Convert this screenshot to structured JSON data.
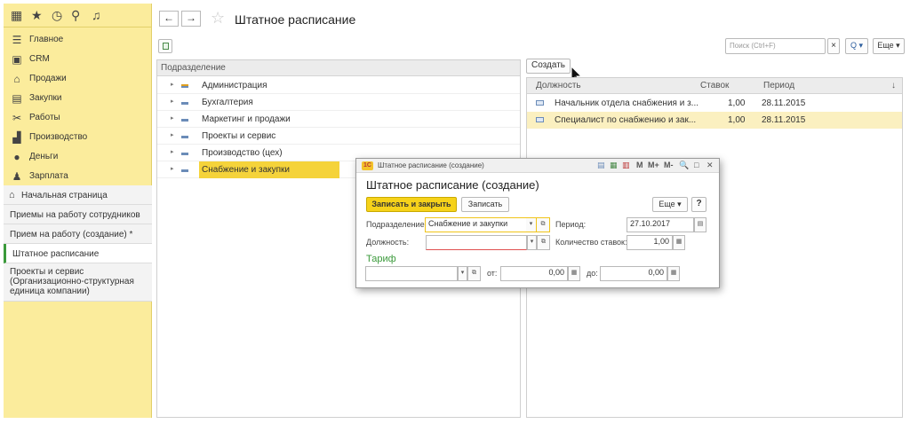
{
  "sidebar": {
    "sections": [
      {
        "label": "Главное",
        "icon": "menu-lines-icon"
      },
      {
        "label": "CRM",
        "icon": "crm-icon"
      },
      {
        "label": "Продажи",
        "icon": "sales-icon"
      },
      {
        "label": "Закупки",
        "icon": "purchases-icon"
      },
      {
        "label": "Работы",
        "icon": "works-icon"
      },
      {
        "label": "Производство",
        "icon": "production-icon"
      },
      {
        "label": "Деньги",
        "icon": "money-icon"
      },
      {
        "label": "Зарплата",
        "icon": "salary-icon"
      }
    ],
    "open_windows": [
      {
        "label": "Начальная страница"
      },
      {
        "label": "Приемы на работу сотрудников"
      },
      {
        "label": "Прием на работу (создание) *"
      },
      {
        "label": "Штатное расписание"
      },
      {
        "label_lines": [
          "Проекты и сервис",
          "(Организационно-структурная",
          "единица компании)"
        ]
      }
    ]
  },
  "header": {
    "back": "←",
    "forward": "→",
    "title": "Штатное расписание"
  },
  "toolbar": {
    "search_placeholder": "Поиск (Ctrl+F)",
    "search_clear": "×",
    "search_btn": "Q ▾",
    "more_label": "Еще ▾"
  },
  "departments": {
    "header": "Подразделение",
    "rows": [
      {
        "label": "Администрация"
      },
      {
        "label": "Бухгалтерия"
      },
      {
        "label": "Маркетинг и продажи"
      },
      {
        "label": "Проекты и сервис"
      },
      {
        "label": "Производство (цех)"
      },
      {
        "label": "Снабжение и закупки",
        "selected": true
      }
    ]
  },
  "positions": {
    "create_label": "Создать",
    "headers": {
      "position": "Должность",
      "rate": "Ставок",
      "period": "Период",
      "sort": "↓"
    },
    "rows": [
      {
        "position": "Начальник отдела снабжения и з...",
        "rate": "1,00",
        "period": "28.11.2015"
      },
      {
        "position": "Специалист по снабжению и зак...",
        "rate": "1,00",
        "period": "28.11.2015"
      }
    ]
  },
  "dialog": {
    "app_badge": "1С",
    "window_title": "Штатное расписание (создание)",
    "window_buttons": [
      "M",
      "M+",
      "M-",
      "🔍",
      "□",
      "✕"
    ],
    "heading": "Штатное расписание (создание)",
    "save_close_label": "Записать и закрыть",
    "save_label": "Записать",
    "more_label": "Еще ▾",
    "help_label": "?",
    "dept_label": "Подразделение:",
    "dept_value": "Снабжение и закупки",
    "period_label": "Период:",
    "period_value": "27.10.2017",
    "position_label": "Должность:",
    "position_value": "",
    "rates_label": "Количество ставок:",
    "rates_value": "1,00",
    "tariff_heading": "Тариф",
    "tariff_value": "",
    "from_label": "от:",
    "from_value": "0,00",
    "to_label": "до:",
    "to_value": "0,00"
  },
  "colors": {
    "sidebar_bg": "#fbec9c",
    "selection": "#f5d33a",
    "primary_button": "#f6d21a",
    "accent_green": "#3b9a3b"
  }
}
